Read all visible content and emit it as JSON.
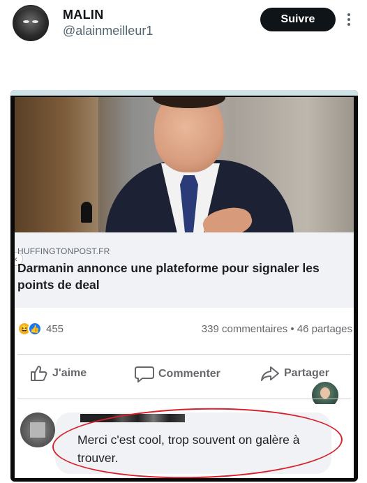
{
  "tweet": {
    "author_name": "MALIN",
    "author_handle": "@alainmeilleur1",
    "follow_label": "Suivre"
  },
  "facebook_post": {
    "link_source": "HUFFINGTONPOST.FR",
    "headline": "Darmanin annonce une plateforme pour signaler les points de deal",
    "reaction_count": "455",
    "comments_and_shares": "339 commentaires • 46 partages",
    "actions": {
      "like": "J'aime",
      "comment": "Commenter",
      "share": "Partager"
    },
    "comment": {
      "text": "Merci c'est cool, trop souvent on galère à trouver."
    }
  },
  "colors": {
    "follow_button_bg": "#0f1419",
    "facebook_blue": "#1877f2",
    "haha_yellow": "#f7b125",
    "highlight_circle": "#d8202a"
  },
  "icons": [
    "more-vertical-icon",
    "thumbs-up-icon",
    "speech-bubble-icon",
    "share-arrow-icon",
    "haha-reaction-icon",
    "like-reaction-icon"
  ]
}
